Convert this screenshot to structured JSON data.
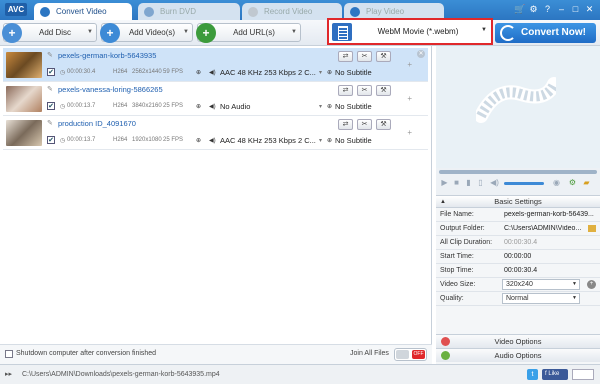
{
  "app": {
    "logo": "AVC"
  },
  "tabs": [
    {
      "label": "Convert Video",
      "active": true,
      "icon": "convert-video-icon"
    },
    {
      "label": "Burn DVD",
      "active": false,
      "icon": "dvd-icon"
    },
    {
      "label": "Record Video",
      "active": false,
      "icon": "record-icon"
    },
    {
      "label": "Play Video",
      "active": false,
      "icon": "play-icon"
    }
  ],
  "toolbar": {
    "add_disc": "Add Disc",
    "add_videos": "Add Video(s)",
    "add_urls": "Add URL(s)",
    "format": "WebM Movie (*.webm)",
    "convert": "Convert Now!"
  },
  "files": [
    {
      "name": "pexels-german-korb-5643935",
      "duration": "00:00:30.4",
      "codec": "H264",
      "resolution": "2562x1440",
      "fps": "59 FPS",
      "audio": "AAC 48 KHz 253 Kbps 2 C...",
      "subtitle": "No Subtitle",
      "selected": true
    },
    {
      "name": "pexels-vanessa-loring-5866265",
      "duration": "00:00:13.7",
      "codec": "H264",
      "resolution": "3840x2160",
      "fps": "25 FPS",
      "audio": "No Audio",
      "subtitle": "No Subtitle",
      "selected": false
    },
    {
      "name": "production ID_4091670",
      "duration": "00:00:13.7",
      "codec": "H264",
      "resolution": "1920x1080",
      "fps": "25 FPS",
      "audio": "AAC 48 KHz 253 Kbps 2 C...",
      "subtitle": "No Subtitle",
      "selected": false
    }
  ],
  "bottom": {
    "shutdown": "Shutdown computer after conversion finished",
    "join_all": "Join All Files",
    "toggle": "OFF"
  },
  "status": {
    "path": "C:\\Users\\ADMIN\\Downloads\\pexels-german-korb-5643935.mp4",
    "like": "Like"
  },
  "settings": {
    "title": "Basic Settings",
    "rows": [
      {
        "label": "File Name:",
        "value": "pexels-german-korb-56439..."
      },
      {
        "label": "Output Folder:",
        "value": "C:\\Users\\ADMIN\\Video..."
      },
      {
        "label": "All Clip Duration:",
        "value": "00:00:30.4"
      },
      {
        "label": "Start Time:",
        "value": "00:00:00"
      },
      {
        "label": "Stop Time:",
        "value": "00:00:30.4"
      },
      {
        "label": "Video Size:",
        "value": "320x240"
      },
      {
        "label": "Quality:",
        "value": "Normal"
      }
    ],
    "video_options": "Video Options",
    "audio_options": "Audio Options"
  },
  "colors": {
    "accent": "#2c76c2",
    "convert": "#1f6cc6",
    "highlight": "#e0282b",
    "selected_row": "#cfe3f8"
  }
}
